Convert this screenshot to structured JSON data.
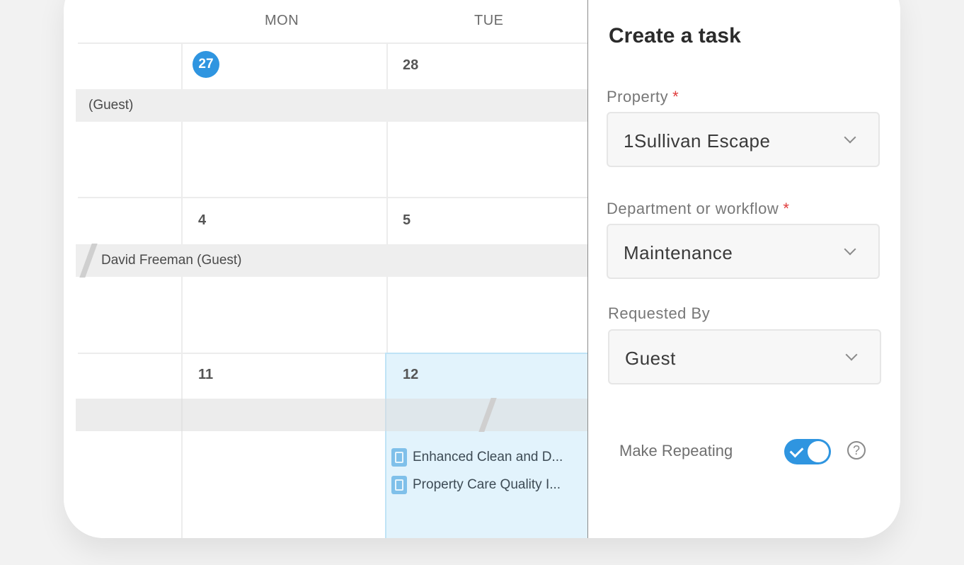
{
  "calendar": {
    "day_headers": [
      "MON",
      "TUE"
    ],
    "weeks": [
      {
        "mon": "27",
        "tue": "28",
        "event": "(Guest)"
      },
      {
        "mon": "4",
        "tue": "5",
        "event": "David Freeman (Guest)"
      },
      {
        "mon": "11",
        "tue": "12",
        "event": ""
      }
    ],
    "tasks": [
      "Enhanced Clean and D...",
      "Property Care Quality I..."
    ]
  },
  "panel": {
    "title": "Create a task",
    "property": {
      "label": "Property",
      "required": "*",
      "value": "1Sullivan Escape"
    },
    "department": {
      "label": "Department or workflow",
      "required": "*",
      "value": "Maintenance"
    },
    "requested_by": {
      "label": "Requested By",
      "value": "Guest"
    },
    "repeating": {
      "label": "Make Repeating",
      "enabled": true
    },
    "help_symbol": "?"
  },
  "colors": {
    "accent": "#2f95e0",
    "required": "#e03b3b",
    "selected_cell": "#e2f3fc"
  }
}
